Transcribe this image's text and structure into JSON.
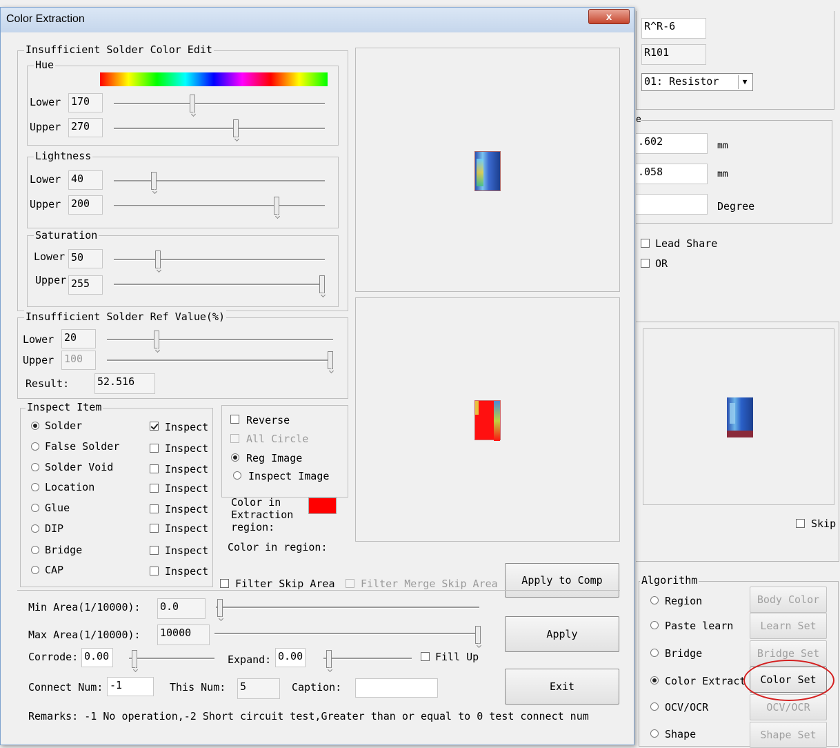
{
  "dialog": {
    "title": "Color Extraction",
    "close_label": "x",
    "color_group": {
      "title": "Insufficient Solder Color Edit",
      "hue": {
        "title": "Hue",
        "lower_label": "Lower",
        "lower_value": "170",
        "upper_label": "Upper",
        "upper_value": "270",
        "lower_level": 0.37,
        "upper_level": 0.58
      },
      "lightness": {
        "title": "Lightness",
        "lower_label": "Lower",
        "lower_value": "40",
        "upper_label": "Upper",
        "upper_value": "200",
        "lower_level": 0.18,
        "upper_level": 0.78
      },
      "saturation": {
        "title": "Saturation",
        "lower_label": "Lower",
        "lower_value": "50",
        "upper_label": "Upper",
        "upper_value": "255",
        "lower_level": 0.2,
        "upper_level": 1.0
      }
    },
    "ref_group": {
      "title": "Insufficient Solder Ref Value(%)",
      "lower_label": "Lower",
      "lower_value": "20",
      "upper_label": "Upper",
      "upper_value": "100",
      "result_label": "Result:",
      "result_value": "52.516"
    },
    "inspect_group": {
      "title": "Inspect Item",
      "items": [
        {
          "label": "Solder",
          "selected": true,
          "inspect_label": "Inspect",
          "inspect_checked": true
        },
        {
          "label": "False Solder",
          "selected": false,
          "inspect_label": "Inspect",
          "inspect_checked": false
        },
        {
          "label": "Solder Void",
          "selected": false,
          "inspect_label": "Inspect",
          "inspect_checked": false
        },
        {
          "label": "Location",
          "selected": false,
          "inspect_label": "Inspect",
          "inspect_checked": false
        },
        {
          "label": "Glue",
          "selected": false,
          "inspect_label": "Inspect",
          "inspect_checked": false
        },
        {
          "label": "DIP",
          "selected": false,
          "inspect_label": "Inspect",
          "inspect_checked": false
        },
        {
          "label": "Bridge",
          "selected": false,
          "inspect_label": "Inspect",
          "inspect_checked": false
        },
        {
          "label": "CAP",
          "selected": false,
          "inspect_label": "Inspect",
          "inspect_checked": false
        }
      ]
    },
    "options_group": {
      "reverse_label": "Reverse",
      "all_circle_label": "All Circle",
      "reg_image_label": "Reg Image",
      "inspect_image_label": "Inspect Image"
    },
    "color_in_extraction_label": "Color in Extraction region:",
    "color_in_extraction_color": "#ff0000",
    "color_in_region_label": "Color in region:",
    "filter_skip_label": "Filter Skip Area",
    "filter_merge_label": "Filter Merge Skip Area",
    "apply_to_comp_label": "Apply to Comp",
    "apply_label": "Apply",
    "exit_label": "Exit",
    "min_area_label": "Min Area(1/10000):",
    "min_area_value": "0.0",
    "max_area_label": "Max Area(1/10000):",
    "max_area_value": "10000",
    "corrode_label": "Corrode:",
    "corrode_value": "0.00",
    "expand_label": "Expand:",
    "expand_value": "0.00",
    "fill_up_label": "Fill Up",
    "connect_num_label": "Connect Num:",
    "connect_num_value": "-1",
    "this_num_label": "This Num:",
    "this_num_value": "5",
    "caption_label": "Caption:",
    "caption_value": "",
    "remarks": "Remarks: -1 No operation,-2 Short circuit test,Greater than or equal to 0 test connect num"
  },
  "background": {
    "field1": "R^R-6",
    "field2": "R101",
    "type_select": "01: Resistor",
    "pos_x": ".602",
    "pos_y": ".058",
    "unit_mm": "mm",
    "degree_label": "Degree",
    "lead_share_label": "Lead Share",
    "or_label": "OR",
    "skip_label": "Skip",
    "algorithm_title": "Algorithm",
    "algorithms": [
      {
        "label": "Region",
        "button": "Body Color",
        "selected": false
      },
      {
        "label": "Paste learn",
        "button": "Learn Set",
        "selected": false
      },
      {
        "label": "Bridge",
        "button": "Bridge Set",
        "selected": false
      },
      {
        "label": "Color Extract",
        "button": "Color Set",
        "selected": true
      },
      {
        "label": "OCV/OCR",
        "button": "OCV/OCR",
        "selected": false
      },
      {
        "label": "Shape",
        "button": "Shape Set",
        "selected": false
      }
    ]
  }
}
